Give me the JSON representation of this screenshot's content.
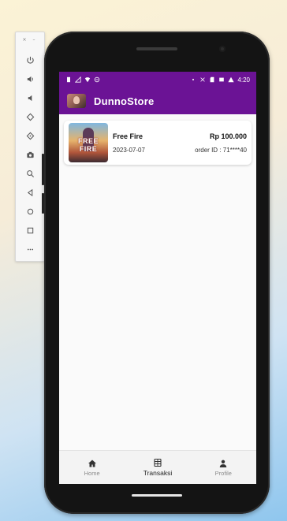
{
  "emulator": {
    "window_controls": "×  –",
    "tools": [
      {
        "name": "power-icon"
      },
      {
        "name": "volume-up-icon"
      },
      {
        "name": "volume-down-icon"
      },
      {
        "name": "rotate-left-icon"
      },
      {
        "name": "rotate-right-icon"
      },
      {
        "name": "camera-icon"
      },
      {
        "name": "zoom-icon"
      },
      {
        "name": "back-icon"
      },
      {
        "name": "home-circle-icon"
      },
      {
        "name": "overview-square-icon"
      },
      {
        "name": "more-icon"
      }
    ]
  },
  "status_bar": {
    "time": "4:20"
  },
  "app_bar": {
    "title": "DunnoStore"
  },
  "transactions": [
    {
      "game": "Free Fire",
      "date": "2023-07-07",
      "price": "Rp 100.000",
      "order_id": "order ID : 71****40",
      "thumb_label": "FREE FIRE"
    }
  ],
  "bottom_nav": {
    "items": [
      {
        "label": "Home",
        "icon": "home-icon",
        "active": false
      },
      {
        "label": "Transaksi",
        "icon": "receipt-icon",
        "active": true
      },
      {
        "label": "Profile",
        "icon": "person-icon",
        "active": false
      }
    ]
  },
  "colors": {
    "primary": "#6b1395",
    "background": "#fafafa"
  }
}
